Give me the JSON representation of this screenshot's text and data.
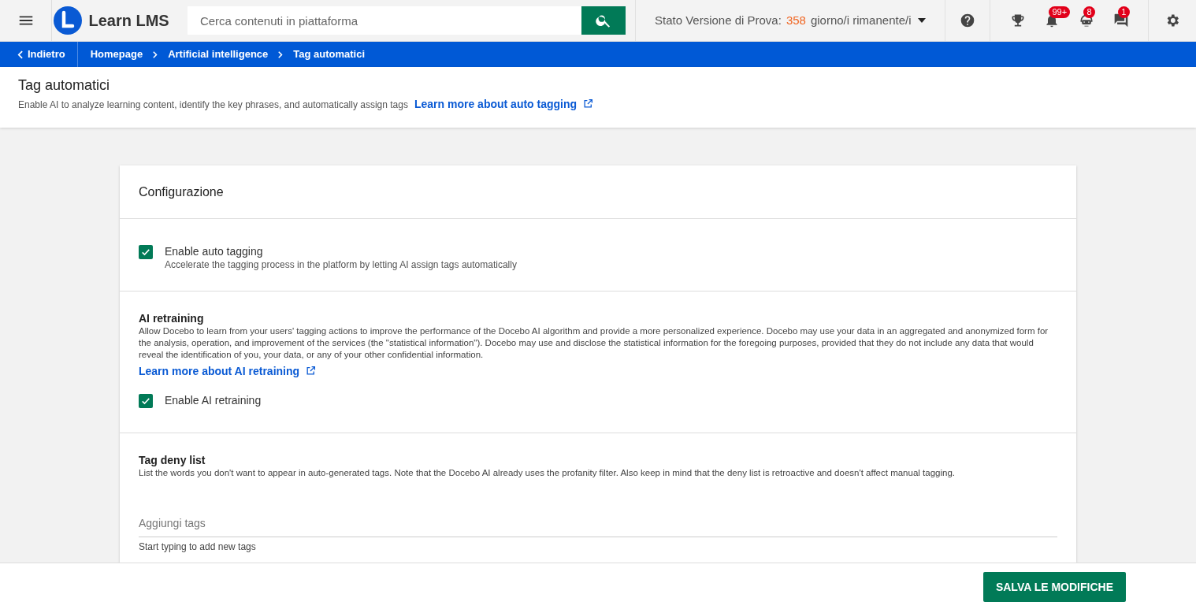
{
  "header": {
    "logo_text": "Learn LMS",
    "search": {
      "placeholder": "Cerca contenuti in piattaforma"
    },
    "trial": {
      "prefix": "Stato Versione di Prova:",
      "count": "358",
      "suffix": "giorno/i rimanente/i"
    },
    "icons": [
      {
        "kind": "help"
      },
      {
        "kind": "trophy"
      },
      {
        "kind": "bell",
        "badge": "99+"
      },
      {
        "kind": "robot",
        "badge": "8"
      },
      {
        "kind": "chat",
        "badge": "1"
      },
      {
        "kind": "gear"
      }
    ]
  },
  "breadcrumb": {
    "back": "Indietro",
    "items": [
      "Homepage",
      "Artificial intelligence",
      "Tag automatici"
    ]
  },
  "page": {
    "title": "Tag automatici",
    "description": "Enable AI to analyze learning content, identify the key phrases, and automatically assign tags",
    "link": "Learn more about auto tagging"
  },
  "card": {
    "title": "Configurazione",
    "sections": [
      {
        "kind": "checkbox",
        "label": "Enable auto tagging",
        "hint": "Accelerate the tagging process in the platform by letting AI assign tags automatically",
        "checked": true
      },
      {
        "kind": "retraining",
        "title": "AI retraining",
        "text": "Allow Docebo to learn from your users' tagging actions to improve the performance of the Docebo AI algorithm and provide a more personalized experience. Docebo may use your data in an aggregated and anonymized form for the analysis, operation, and improvement of the services (the \"statistical information\"). Docebo may use and disclose the statistical information for the foregoing purposes, provided that they do not include any data that would reveal the identification of you, your data, or any of your other confidential information.",
        "link": "Learn more about AI retraining",
        "label": "Enable AI retraining",
        "checked": true
      },
      {
        "kind": "denylist",
        "title": "Tag deny list",
        "text": "List the words you don't want to appear in auto-generated tags. Note that the Docebo AI already uses the profanity filter. Also keep in mind that the deny list is retroactive and doesn't affect manual tagging.",
        "placeholder": "Aggiungi tags",
        "hint": "Start typing to add new tags"
      }
    ]
  },
  "footer": {
    "button": "SALVA LE MODIFICHE"
  }
}
